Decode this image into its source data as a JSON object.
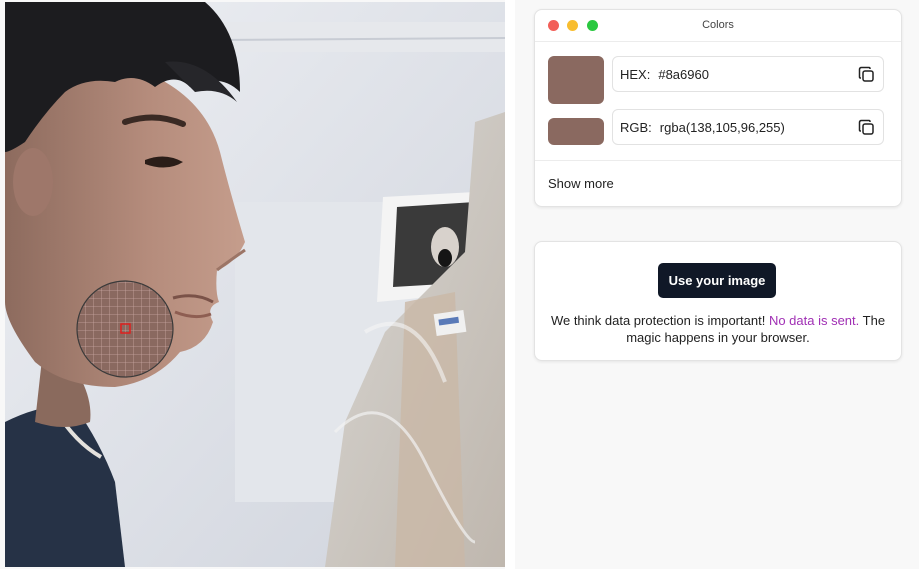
{
  "window": {
    "title": "Colors"
  },
  "picker": {
    "color_hex": "#8a6960"
  },
  "colors": {
    "hex": {
      "label": "HEX:",
      "value": "#8a6960"
    },
    "rgb": {
      "label": "RGB:",
      "value": "rgba(138,105,96,255)"
    },
    "show_more": "Show more"
  },
  "upload": {
    "button_label": "Use your image",
    "notice_prefix": "We think data protection is important!",
    "notice_accent": "No data is sent.",
    "notice_suffix": "The magic happens in your browser."
  },
  "theme": {
    "swatch_color": "#8a6960",
    "accent_color": "#a02fb4",
    "button_color": "#101827"
  },
  "icons": [
    "copy-icon",
    "copy-icon"
  ]
}
